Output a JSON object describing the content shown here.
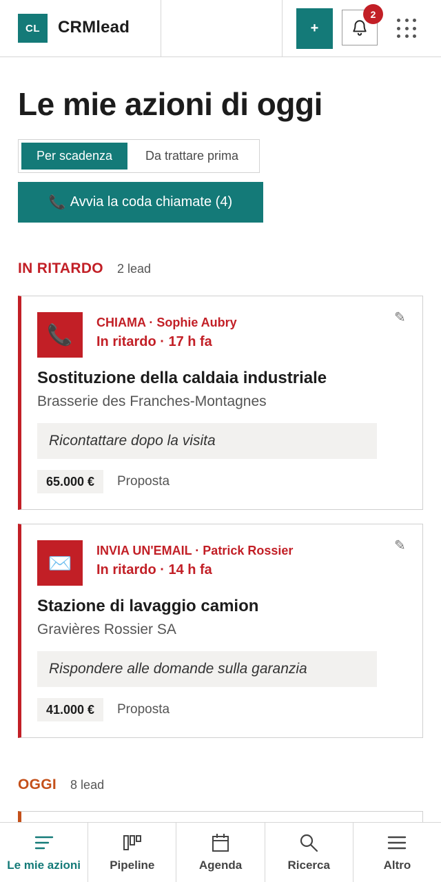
{
  "header": {
    "logo_text": "CL",
    "app_name": "CRMlead",
    "add_label": "+",
    "notification_count": "2"
  },
  "page": {
    "title": "Le mie azioni di oggi"
  },
  "sort_toggle": {
    "options": [
      {
        "label": "Per scadenza",
        "active": true
      },
      {
        "label": "Da trattare prima",
        "active": false
      }
    ]
  },
  "call_queue": {
    "icon": "📞",
    "label": "Avvia la coda chiamate (4)"
  },
  "sections": [
    {
      "title": "IN RITARDO",
      "count": "2 lead",
      "color": "#c21f26",
      "cards": [
        {
          "action_type": "CHIAMA",
          "separator": " · ",
          "contact": "Sophie Aubry",
          "due": "In ritardo · 17 h fa",
          "icon_name": "phone-icon",
          "icon_glyph": "📞",
          "deal": "Sostituzione della caldaia industriale",
          "company": "Brasserie des Franches-Montagnes",
          "note": "Ricontattare dopo la visita",
          "amount": "65.000 €",
          "stage": "Proposta"
        },
        {
          "action_type": "INVIA UN'EMAIL",
          "separator": " · ",
          "contact": "Patrick Rossier",
          "due": "In ritardo · 14 h fa",
          "icon_name": "envelope-icon",
          "icon_glyph": "✉️",
          "deal": "Stazione di lavaggio camion",
          "company": "Gravières Rossier SA",
          "note": "Rispondere alle domande sulla garanzia",
          "amount": "41.000 €",
          "stage": "Proposta"
        }
      ]
    },
    {
      "title": "OGGI",
      "count": "8 lead",
      "color": "#c4501a"
    }
  ],
  "bottom_nav": [
    {
      "label": "Le mie azioni",
      "icon": "list-icon",
      "active": true
    },
    {
      "label": "Pipeline",
      "icon": "kanban-icon",
      "active": false
    },
    {
      "label": "Agenda",
      "icon": "calendar-icon",
      "active": false
    },
    {
      "label": "Ricerca",
      "icon": "search-icon",
      "active": false
    },
    {
      "label": "Altro",
      "icon": "menu-icon",
      "active": false
    }
  ],
  "colors": {
    "brand": "#147a78",
    "overdue": "#c21f26",
    "today": "#c4501a"
  }
}
